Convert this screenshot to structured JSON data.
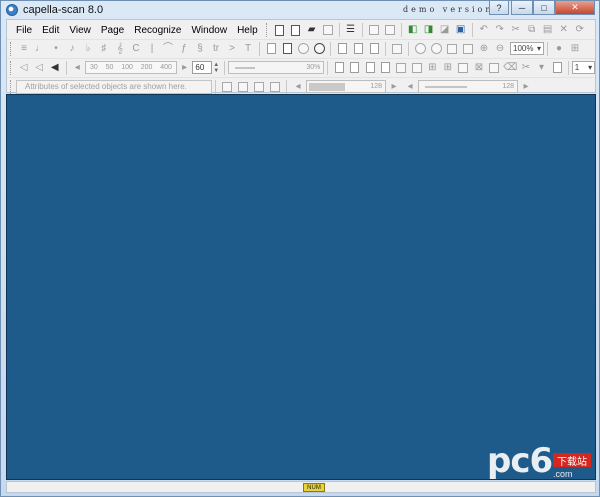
{
  "window": {
    "title": "capella-scan 8.0",
    "banner": "demo version",
    "buttons": {
      "help": "?",
      "minimize": "─",
      "maximize": "□",
      "close": "✕"
    }
  },
  "menu": {
    "items": [
      {
        "label": "File"
      },
      {
        "label": "Edit"
      },
      {
        "label": "View"
      },
      {
        "label": "Page"
      },
      {
        "label": "Recognize"
      },
      {
        "label": "Window"
      },
      {
        "label": "Help"
      }
    ]
  },
  "toolbar": {
    "zoom_value": "100%",
    "ruler_ticks": [
      "30",
      "50",
      "100",
      "200",
      "400"
    ],
    "number_value": "60",
    "percent_value": "30%",
    "dropdown_value": "1"
  },
  "attributes_bar": {
    "hint": "Attributes of selected objects are shown here.",
    "slider1_value": "128",
    "slider2_value": "128"
  },
  "status": {
    "indicator": "NUM"
  },
  "watermark": {
    "text": "pc6",
    "badge": "下载站",
    "sub": ".com"
  },
  "colors": {
    "workspace": "#1f5b8a",
    "chrome": "#dbe8f6",
    "close_button": "#c6452d"
  }
}
